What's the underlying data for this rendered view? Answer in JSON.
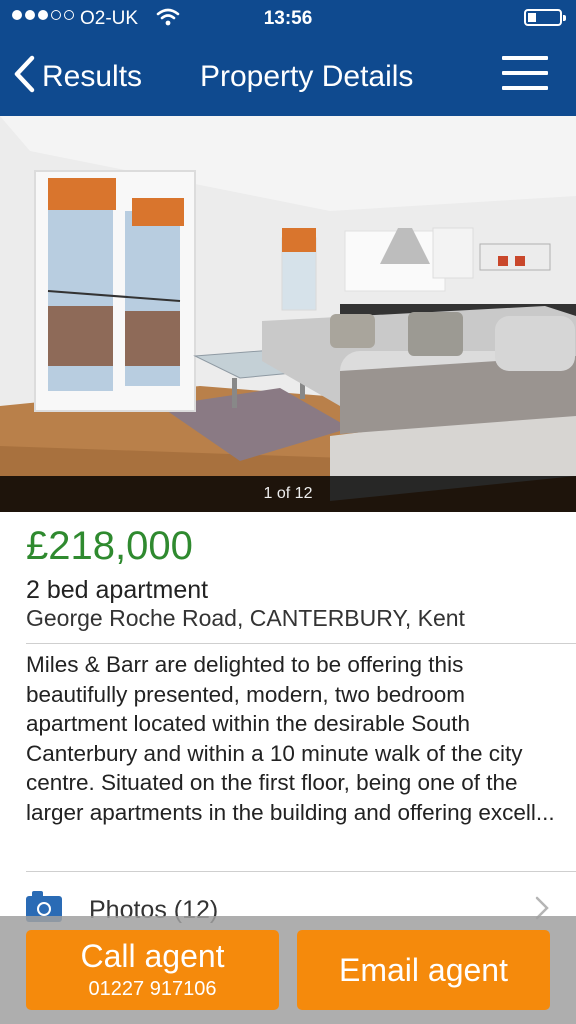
{
  "status_bar": {
    "carrier": "O2-UK",
    "time": "13:56",
    "signal_bars_filled": 3,
    "signal_bars_total": 5,
    "battery_level": 0.15
  },
  "nav": {
    "back_label": "Results",
    "title": "Property Details",
    "menu_icon": "hamburger-menu-icon"
  },
  "gallery": {
    "counter": "1 of 12"
  },
  "property": {
    "price": "£218,000",
    "type": "2 bed apartment",
    "address": "George Roche Road, CANTERBURY, Kent",
    "description": "Miles & Barr are delighted to be offering this beautifully presented, modern, two bedroom apartment located within the desirable South Canterbury and within a 10 minute walk of the city centre. Situated on the first floor, being one of the larger apartments in the building and offering excell..."
  },
  "photos_link": {
    "label": "Photos (12)",
    "icon": "camera-icon"
  },
  "actions": {
    "call_label": "Call agent",
    "call_number": "01227 917106",
    "email_label": "Email agent"
  },
  "colors": {
    "brand_blue": "#0f4a8f",
    "price_green": "#2f8a2f",
    "action_orange": "#f58a0c"
  }
}
